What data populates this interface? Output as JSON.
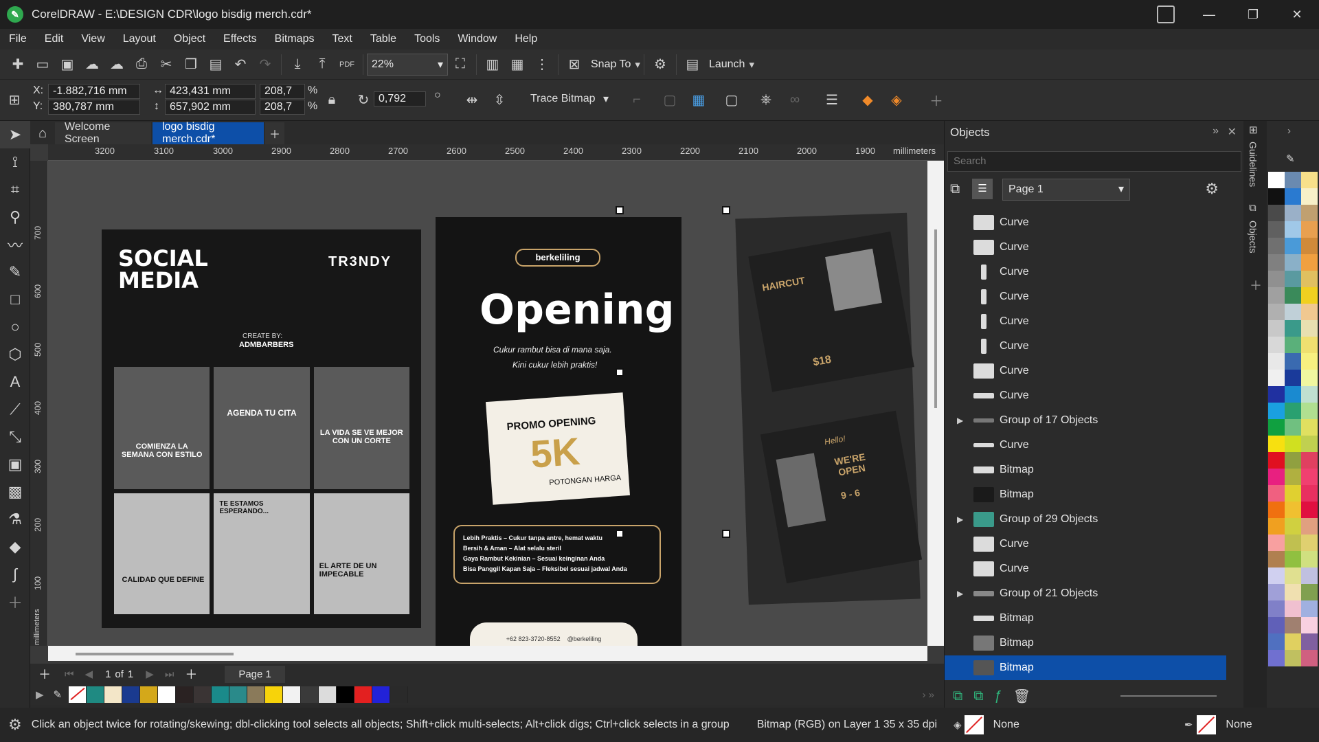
{
  "window": {
    "title": "CorelDRAW - E:\\DESIGN CDR\\logo bisdig merch.cdr*",
    "minimize": "—",
    "restore": "❐",
    "close": "✕"
  },
  "menu": [
    "File",
    "Edit",
    "View",
    "Layout",
    "Object",
    "Effects",
    "Bitmaps",
    "Text",
    "Table",
    "Tools",
    "Window",
    "Help"
  ],
  "toolbar": {
    "zoom": "22%",
    "snap_to": "Snap To",
    "launch": "Launch",
    "pdf": "PDF"
  },
  "property_bar": {
    "x": "-1.882,716 mm",
    "y": "380,787 mm",
    "x_label": "X:",
    "y_label": "Y:",
    "width": "423,431 mm",
    "height": "657,902 mm",
    "scale_w": "208,7",
    "scale_h": "208,7",
    "pct": "%",
    "rotation": "0,792",
    "trace_bitmap": "Trace Bitmap"
  },
  "tabs": {
    "welcome": "Welcome Screen",
    "doc": "logo bisdig merch.cdr*"
  },
  "ruler": {
    "h_ticks": [
      "3200",
      "3100",
      "3000",
      "2900",
      "2800",
      "2700",
      "2600",
      "2500",
      "2400",
      "2300",
      "2200",
      "2100",
      "2000",
      "1900"
    ],
    "unit": "millimeters",
    "v_ticks": [
      "700",
      "600",
      "500",
      "400",
      "300",
      "200",
      "100"
    ],
    "v_unit": "millimeters"
  },
  "artwork": {
    "social_title": "SOCIAL MEDIA",
    "trendy": "TR3NDY",
    "create_by": "CREATE BY:",
    "admbarbers": "ADMBARBERS",
    "grid_captions": [
      "COMIENZA LA SEMANA CON ESTILO",
      "AGENDA TU CITA",
      "LA VIDA SE VE MEJOR CON UN CORTE",
      "CALIDAD QUE DEFINE",
      "TE ESTAMOS ESPERANDO...",
      "EL ARTE DE UN IMPECABLE"
    ],
    "brand": "berkeliling",
    "opening": "Opening",
    "tagline1": "Cukur rambut bisa di mana saja.",
    "tagline2": "Kini cukur lebih praktis!",
    "promo": "PROMO OPENING",
    "promo_value": "5K",
    "promo_sub": "POTONGAN HARGA",
    "benefits": [
      "Lebih Praktis – Cukur tanpa antre, hemat waktu",
      "Bersih & Aman – Alat selalu steril",
      "Gaya Rambut Kekinian – Sesuai keinginan Anda",
      "Bisa Panggil Kapan Saja – Fleksibel sesuai jadwal Anda"
    ],
    "phone": "+62 823-3720-8552",
    "handle": "@berkeliling",
    "haircut": "HAIRCUT",
    "price": "$18",
    "hello": "Hello!",
    "were_open": "WE'RE OPEN",
    "hours": "9 - 6"
  },
  "pagenav": {
    "current": "1",
    "of": "of",
    "total": "1",
    "page_tab": "Page 1"
  },
  "objects_panel": {
    "title": "Objects",
    "search_placeholder": "Search",
    "page": "Page 1",
    "items": [
      {
        "label": "Curve",
        "expandable": false
      },
      {
        "label": "Curve",
        "expandable": false
      },
      {
        "label": "Curve",
        "expandable": false
      },
      {
        "label": "Curve",
        "expandable": false
      },
      {
        "label": "Curve",
        "expandable": false
      },
      {
        "label": "Curve",
        "expandable": false
      },
      {
        "label": "Curve",
        "expandable": false
      },
      {
        "label": "Curve",
        "expandable": false
      },
      {
        "label": "Group of 17 Objects",
        "expandable": true
      },
      {
        "label": "Curve",
        "expandable": false
      },
      {
        "label": "Bitmap",
        "expandable": false
      },
      {
        "label": "Bitmap",
        "expandable": false
      },
      {
        "label": "Group of 29 Objects",
        "expandable": true
      },
      {
        "label": "Curve",
        "expandable": false
      },
      {
        "label": "Curve",
        "expandable": false
      },
      {
        "label": "Group of 21 Objects",
        "expandable": true
      },
      {
        "label": "Bitmap",
        "expandable": false
      },
      {
        "label": "Bitmap",
        "expandable": false
      },
      {
        "label": "Bitmap",
        "expandable": false,
        "selected": true
      }
    ]
  },
  "side_tabs": {
    "guidelines": "Guidelines",
    "objects": "Objects"
  },
  "statusbar": {
    "hint": "Click an object twice for rotating/skewing; dbl-clicking tool selects all objects; Shift+click multi-selects; Alt+click digs; Ctrl+click selects in a group",
    "info": "Bitmap (RGB) on Layer 1  35 x 35 dpi",
    "fill": "None",
    "outline": "None"
  },
  "palette_colors": [
    "#1f8a82",
    "#f3e6c8",
    "#1a3a8f",
    "#d4a81a",
    "#ffffff",
    "#2a2222",
    "#3a3434",
    "#1a8a8a",
    "#2a8a8a",
    "#8a7a5a",
    "#f7d30a",
    "#f2f2f2",
    "#3a3a3a",
    "#dcdcdc",
    "#000000",
    "#e32020",
    "#2222d8",
    "#2a2a2a"
  ],
  "docker_colors": [
    "#ffffff",
    "#6a8ab0",
    "#f7e08a",
    "#111111",
    "#2a7ad0",
    "#f7f0c8",
    "#4a4a4a",
    "#9ab0c8",
    "#c0a070",
    "#606060",
    "#a0c8e8",
    "#e8a050",
    "#707070",
    "#4a9ad8",
    "#d08a3a",
    "#808080",
    "#8ab0c8",
    "#f0a040",
    "#909090",
    "#5a9aa0",
    "#e0c060",
    "#a0a0a0",
    "#3a8a5a",
    "#f0d020",
    "#b0b0b0",
    "#c0d0d8",
    "#f0c890",
    "#c8c8c8",
    "#3a9a8a",
    "#e8e0b0",
    "#d8d8d8",
    "#5ab07a",
    "#f0e070",
    "#e8e8e8",
    "#3a6ab0",
    "#f7f080",
    "#f0f0f0",
    "#1a3a9a",
    "#f0f7a0",
    "#2030a0",
    "#1a8ad0",
    "#c0e0d0",
    "#1aa0e0",
    "#2aa070",
    "#b0e090",
    "#10a040",
    "#70c080",
    "#e0e060",
    "#f7e010",
    "#d0e020",
    "#c0d050",
    "#e01020",
    "#90a040",
    "#e04060",
    "#e82080",
    "#b0b040",
    "#f04070",
    "#f06080",
    "#e0d030",
    "#e83060",
    "#f07010",
    "#f0c030",
    "#e01040",
    "#f0a020",
    "#d0d040",
    "#e0a080",
    "#f8a0a0",
    "#c0c050",
    "#e0d070",
    "#b08050",
    "#90c040",
    "#d0e080",
    "#d0d0f0",
    "#e0e090",
    "#c0c0e0",
    "#a0a0d8",
    "#f0e0b0",
    "#80a050",
    "#8080c8",
    "#f0c0d0",
    "#a0b0e0",
    "#6060b8",
    "#a08070",
    "#f8d0e0",
    "#5070c0",
    "#e0d060",
    "#8060a0",
    "#7070d0",
    "#c0c060",
    "#d06080"
  ]
}
